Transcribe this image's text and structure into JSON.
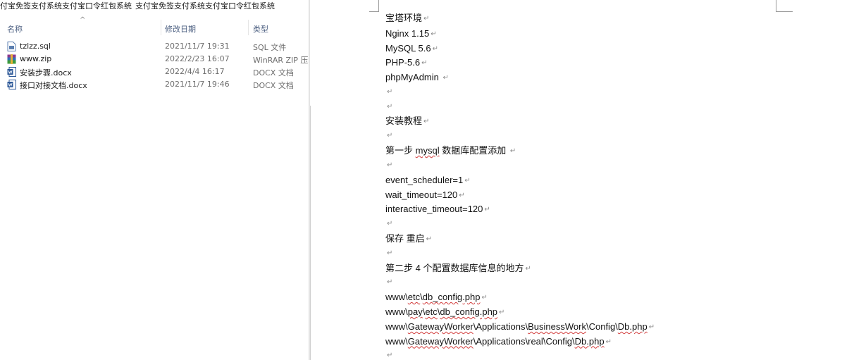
{
  "explorer": {
    "breadcrumb": {
      "crumb1": "付宝免签支付系统支付宝口令红包系统",
      "crumb2": "支付宝免签支付系统支付宝口令红包系统",
      "separator": "›"
    },
    "columns": {
      "name": "名称",
      "modified": "修改日期",
      "type": "类型",
      "sort_arrow": "^"
    },
    "files": [
      {
        "name": "tzlzz.sql",
        "date": "2021/11/7 19:31",
        "type": "SQL 文件",
        "icon": "sql-file-icon",
        "color": "#5b7fb0"
      },
      {
        "name": "www.zip",
        "date": "2022/2/23 16:07",
        "type": "WinRAR ZIP 压缩",
        "icon": "winrar-zip-icon",
        "color": "#8b3a8f"
      },
      {
        "name": "安装步骤.docx",
        "date": "2022/4/4 16:17",
        "type": "DOCX 文档",
        "icon": "word-doc-icon",
        "color": "#2b5797"
      },
      {
        "name": "接口对接文档.docx",
        "date": "2021/11/7 19:46",
        "type": "DOCX 文档",
        "icon": "word-doc-icon",
        "color": "#2b5797"
      }
    ]
  },
  "document": {
    "return_mark": "↵",
    "lines": [
      {
        "text": "宝塔环境"
      },
      {
        "text": "Nginx 1.15"
      },
      {
        "text": "MySQL 5.6"
      },
      {
        "text": "PHP-5.6"
      },
      {
        "text": "phpMyAdmin "
      },
      {
        "text": ""
      },
      {
        "text": ""
      },
      {
        "text": "安装教程"
      },
      {
        "text": ""
      },
      {
        "text": "第一步   mysql   数据库配置添加  "
      },
      {
        "text": ""
      },
      {
        "text": "event_scheduler=1"
      },
      {
        "text": "wait_timeout=120"
      },
      {
        "text": "interactive_timeout=120"
      },
      {
        "text": ""
      },
      {
        "text": "保存  重启"
      },
      {
        "text": ""
      },
      {
        "text": "第二步   4 个配置数据库信息的地方"
      },
      {
        "text": ""
      },
      {
        "text": "www\\etc\\db_config.php"
      },
      {
        "text": "www\\pay\\etc\\db_config.php"
      },
      {
        "text": "www\\GatewayWorker\\Applications\\BusinessWork\\Config\\Db.php"
      },
      {
        "text": "www\\GatewayWorker\\Applications\\real\\Config\\Db.php"
      },
      {
        "text": ""
      }
    ]
  }
}
